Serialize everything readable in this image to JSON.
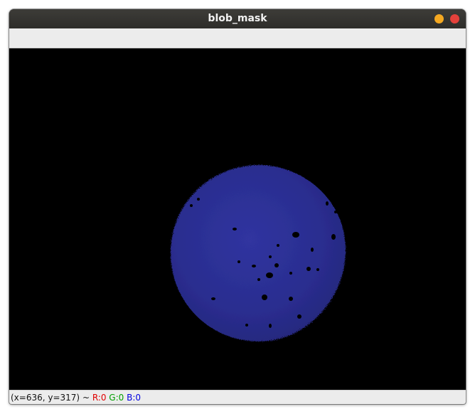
{
  "window": {
    "title": "blob_mask",
    "minimize_color": "#f4a821",
    "close_color": "#e4413b"
  },
  "canvas": {
    "background": "#000000",
    "blob_color": "#2b2f93"
  },
  "status": {
    "coords": "(x=636, y=317)",
    "separator": " ~ ",
    "r_label": "R:0",
    "g_label": "G:0",
    "b_label": "B:0",
    "r_color": "#e00000",
    "g_color": "#00a000",
    "b_color": "#0000e0"
  }
}
